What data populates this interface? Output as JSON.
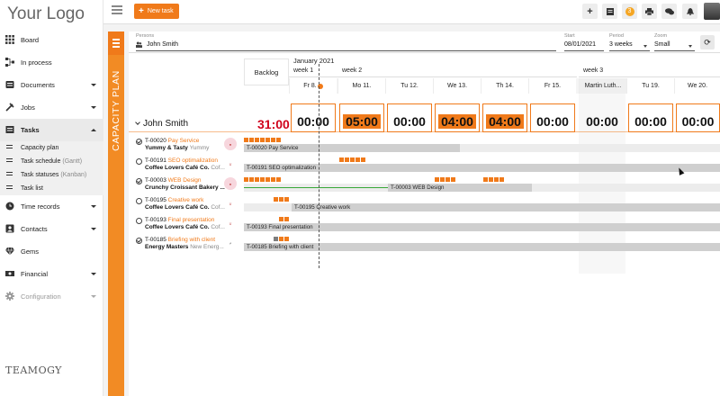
{
  "app": {
    "logo": "Your Logo",
    "brand": "TEAMOGY"
  },
  "sidebar": {
    "items": [
      {
        "label": "Board",
        "icon": "grid-icon"
      },
      {
        "label": "In process",
        "icon": "flow-icon"
      },
      {
        "label": "Documents",
        "icon": "documents-icon"
      },
      {
        "label": "Jobs",
        "icon": "jobs-icon"
      },
      {
        "label": "Tasks",
        "icon": "tasks-icon"
      },
      {
        "label": "Time records",
        "icon": "clock-icon"
      },
      {
        "label": "Contacts",
        "icon": "contacts-icon"
      },
      {
        "label": "Gems",
        "icon": "gem-icon"
      },
      {
        "label": "Financial",
        "icon": "financial-icon"
      },
      {
        "label": "Configuration",
        "icon": "gear-icon"
      }
    ],
    "task_sub": [
      {
        "label": "Capacity plan",
        "extra": ""
      },
      {
        "label": "Task schedule",
        "extra": "(Gantt)"
      },
      {
        "label": "Task statuses",
        "extra": "(Kanban)"
      },
      {
        "label": "Task list",
        "extra": ""
      }
    ]
  },
  "topbar": {
    "new_task": "New task",
    "notification_count": "3"
  },
  "capacity": {
    "strip_label": "CAPACITY PLAN",
    "filter": {
      "persons_label": "Persons",
      "persons_value": "John Smith",
      "start_label": "Start",
      "start_value": "08/01/2021",
      "period_label": "Period",
      "period_value": "3 weeks",
      "zoom_label": "Zoom",
      "zoom_value": "Small"
    },
    "backlog": "Backlog",
    "month": "January 2021",
    "weeks": [
      "week 1",
      "week 2",
      "week 3"
    ],
    "days": [
      "Fr 8.",
      "Mo 11.",
      "Tu 12.",
      "We 13.",
      "Th 14.",
      "Fr 15.",
      "Martin Luth...",
      "Tu 19.",
      "We 20."
    ],
    "person": "John Smith",
    "total": "31:00",
    "hours": [
      "00:00",
      "05:00",
      "00:00",
      "04:00",
      "04:00",
      "00:00",
      "00:00",
      "00:00",
      "00:00"
    ]
  },
  "tasks": [
    {
      "id": "T-00020",
      "name": "Pay Service",
      "client": "Yummy & Tasty",
      "client_extra": "Yummy",
      "bar": "T-00020 Pay Service",
      "done": true
    },
    {
      "id": "T-00191",
      "name": "SEO optimalization",
      "client": "Coffee Lovers Café Co.",
      "client_extra": "Cof...",
      "bar": "T-00191 SEO optimalization",
      "done": false
    },
    {
      "id": "T-00003",
      "name": "WEB Design",
      "client": "Crunchy Croissant Bakery ...",
      "client_extra": "",
      "bar": "T-00003 WEB Design",
      "done": true
    },
    {
      "id": "T-00195",
      "name": "Creative work",
      "client": "Coffee Lovers Café Co.",
      "client_extra": "Cof...",
      "bar": "T-00195 Creative work",
      "done": false
    },
    {
      "id": "T-00193",
      "name": "Final presentation",
      "client": "Coffee Lovers Café Co.",
      "client_extra": "Cof...",
      "bar": "T-00193 Final presentation",
      "done": false
    },
    {
      "id": "T-00185",
      "name": "Briefing with client",
      "client": "Energy Masters",
      "client_extra": "New Energ...",
      "bar": "T-00185 Briefing with client",
      "done": true
    }
  ],
  "colors": {
    "accent": "#f07a1a",
    "over_capacity": "#d0021b"
  }
}
